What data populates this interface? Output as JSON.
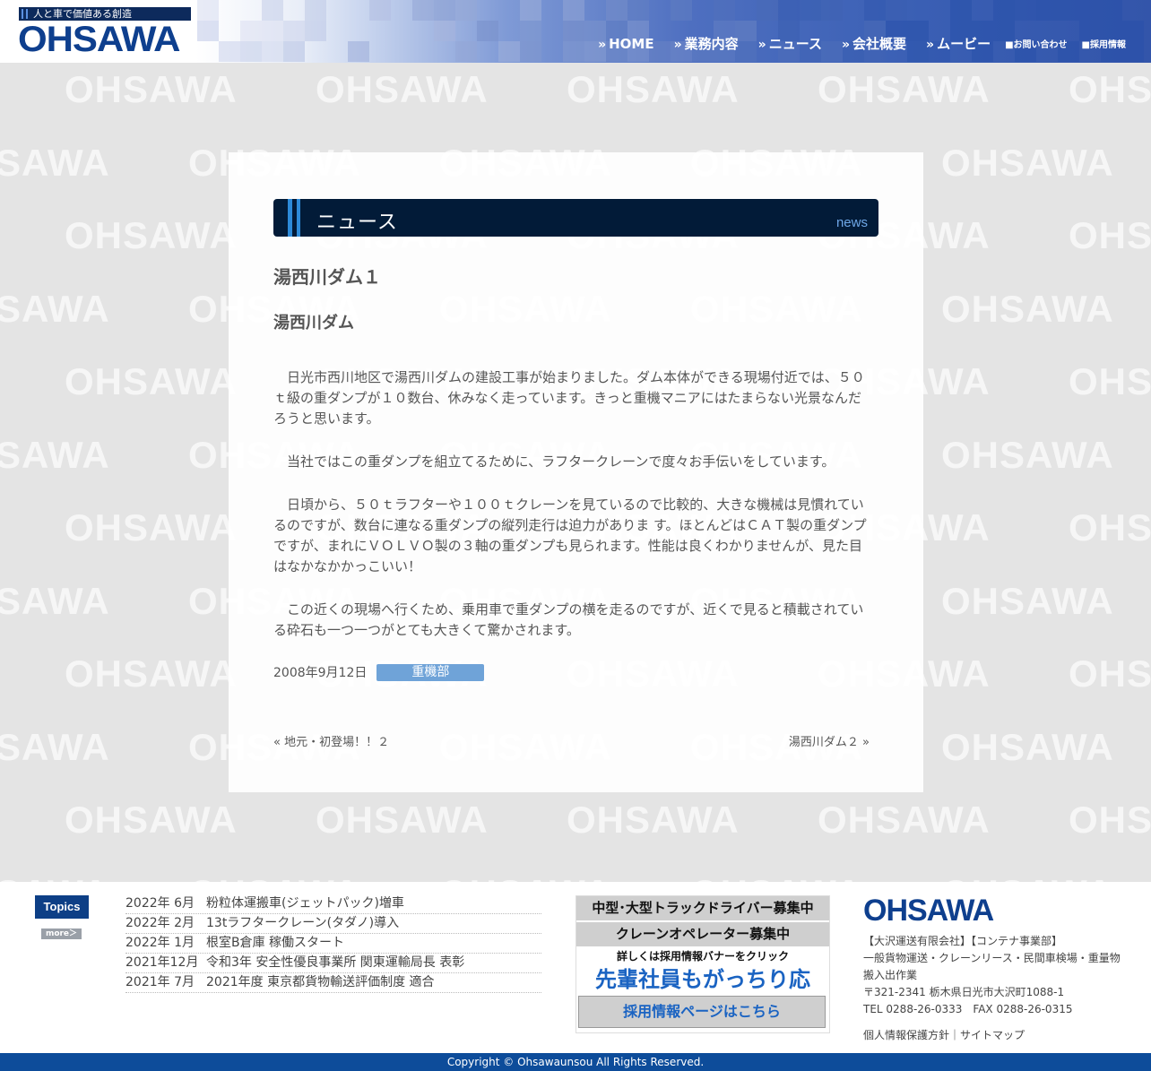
{
  "header": {
    "tagline": "人と車で価値ある創造",
    "logo": "OHSAWA",
    "nav": [
      {
        "label": "HOME"
      },
      {
        "label": "業務内容"
      },
      {
        "label": "ニュース"
      },
      {
        "label": "会社概要"
      },
      {
        "label": "ムービー"
      }
    ],
    "nav_small": [
      {
        "label": "■お問い合わせ"
      },
      {
        "label": "■採用情報"
      }
    ]
  },
  "watermark": "OHSAWA",
  "section": {
    "title": "ニュース",
    "subtitle": "news"
  },
  "post": {
    "title": "湯西川ダム１",
    "subtitle": "湯西川ダム",
    "paragraphs": [
      "　日光市西川地区で湯西川ダムの建設工事が始まりました。ダム本体ができる現場付近では、５０ｔ級の重ダンプが１０数台、休みなく走っています。きっと重機マニアにはたまらない光景なんだろうと思います。",
      "　当社ではこの重ダンプを組立てるために、ラフタークレーンで度々お手伝いをしています。",
      "　日頃から、５０ｔラフターや１００ｔクレーンを見ているので比較的、大きな機械は見慣れているのですが、数台に連なる重ダンプの縦列走行は迫力がありま す。ほとんどはＣＡＴ製の重ダンプですが、まれにＶＯＬＶＯ製の３軸の重ダンプも見られます。性能は良くわかりませんが、見た目はなかなかかっこいい！",
      "　この近くの現場へ行くため、乗用車で重ダンプの横を走るのですが、近くで見ると積載されている砕石も一つ一つがとても大きくて驚かされます。"
    ],
    "date": "2008年9月12日",
    "category": "重機部",
    "prev": "« 地元・初登場！！２",
    "next": "湯西川ダム２ »"
  },
  "footer": {
    "topics_label": "Topics",
    "more_label": "more＞",
    "news": [
      {
        "date": "2022年 6月",
        "title": "粉粒体運搬車(ジェットパック)増車"
      },
      {
        "date": "2022年 2月",
        "title": "13tラフタークレーン(タダノ)導入"
      },
      {
        "date": "2022年 1月",
        "title": "根室B倉庫 稼働スタート"
      },
      {
        "date": "2021年12月",
        "title": "令和3年 安全性優良事業所 関東運輸局長 表彰"
      },
      {
        "date": "2021年 7月",
        "title": "2021年度 東京都貨物輸送評価制度 適合"
      }
    ],
    "recruit": {
      "line1": "中型･大型トラックドライバー募集中",
      "line2": "クレーンオペレーター募集中",
      "line3": "詳しくは採用情報バナーをクリック",
      "line4": "先輩社員もがっちり応援!!",
      "line5": "採用情報ページはこちら"
    },
    "logo": "OHSAWA",
    "company_lines": [
      "【大沢運送有限会社】【コンテナ事業部】",
      "一般貨物運送・クレーンリース・民間車検場・重量物搬入出作業",
      "〒321-2341 栃木県日光市大沢町1088-1",
      "TEL 0288-26-0333　FAX 0288-26-0315"
    ],
    "privacy_link": "個人情報保護方針",
    "link_sep": "｜",
    "sitemap_link": "サイトマップ",
    "copyright": "Copyright © Ohsawaunsou All Rights Reserved."
  }
}
